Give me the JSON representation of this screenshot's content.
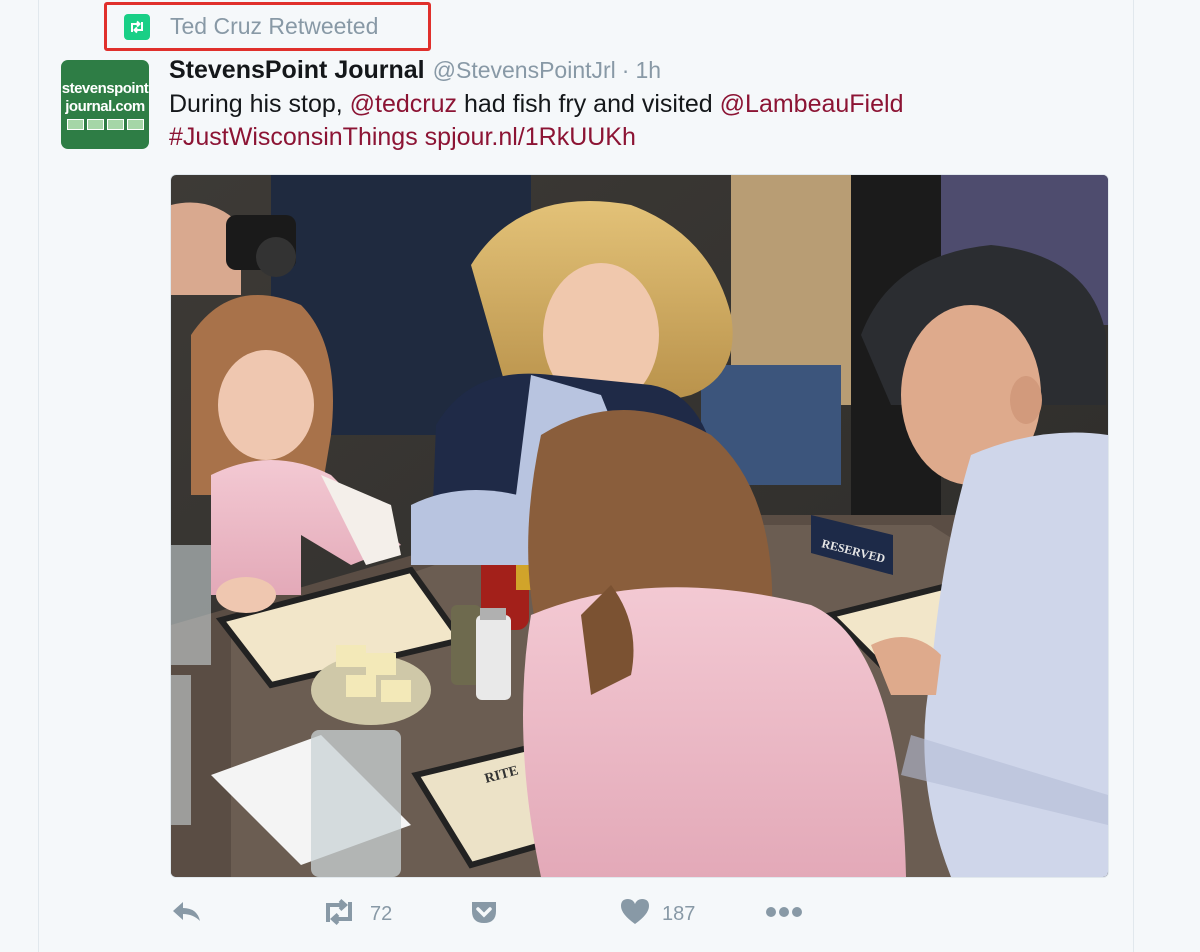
{
  "retweet_context": {
    "text": "Ted Cruz Retweeted",
    "icon": "retweet-icon",
    "accent": "#19cf86",
    "highlight_color": "#e0302c"
  },
  "author": {
    "avatar_text_line1": "stevenspoint",
    "avatar_text_line2": "journal.com",
    "name": "StevensPoint Journal",
    "handle": "@StevensPointJrl",
    "separator": "·",
    "time": "1h"
  },
  "tweet": {
    "part1": "During his stop, ",
    "mention1": "@tedcruz",
    "part2": " had fish fry and visited ",
    "mention2": "@LambeauField",
    "hashtag": "#JustWisconsinThings",
    "url": "spjour.nl/1RkUUKh",
    "link_color": "#8c1434"
  },
  "photo": {
    "reserved_sign": "RESERVED",
    "menu_text": "RITE"
  },
  "actions": {
    "reply_icon": "reply-icon",
    "retweet_icon": "retweet-icon",
    "retweet_count": "72",
    "pocket_icon": "pocket-icon",
    "like_icon": "heart-icon",
    "like_count": "187",
    "more_icon": "more-icon"
  }
}
